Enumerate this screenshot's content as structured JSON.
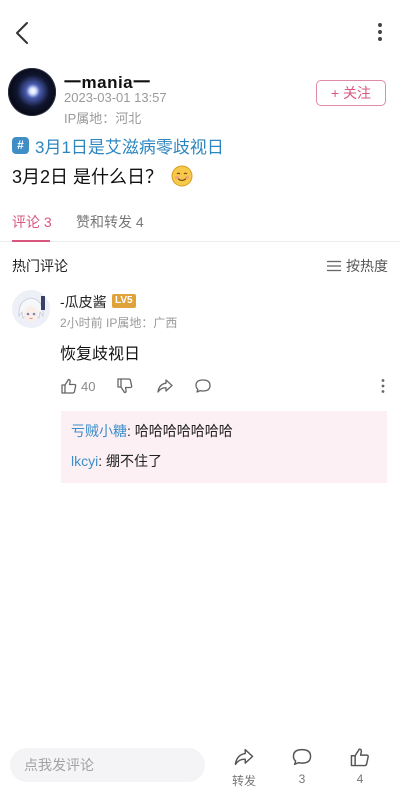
{
  "post": {
    "author_name": "一mania一",
    "time": "2023-03-01 13:57",
    "ip": "IP属地：河北",
    "follow_label": "+ 关注",
    "topic_icon": "#",
    "topic": "3月1日是艾滋病零歧视日",
    "body": "3月2日 是什么日？"
  },
  "tabs": {
    "comments": "评论 3",
    "likes_shares": "赞和转发 4"
  },
  "comments_section": {
    "title": "热门评论",
    "sort_label": "按热度"
  },
  "comment": {
    "username": "-瓜皮酱",
    "level": "LV5",
    "meta": "2小时前  IP属地：广西",
    "text": "恢复歧视日",
    "likes": "40",
    "replies": [
      {
        "user": "亏贼小糖",
        "text": "哈哈哈哈哈哈哈"
      },
      {
        "user": "lkcyi",
        "text": "绷不住了"
      }
    ]
  },
  "bottom_bar": {
    "input_placeholder": "点我发评论",
    "share_label": "转发",
    "comment_count": "3",
    "like_count": "4"
  },
  "colors": {
    "accent": "#d9577f",
    "link": "#2e86c1",
    "reply_bg": "#fcf0f5",
    "level_badge": "#e0a33a"
  },
  "icons": {
    "back": "chevron-left-icon",
    "more": "vertical-dots-icon",
    "topic": "hashtag-icon",
    "emoji": "blushing-smile-emoji-icon",
    "sort": "sort-lines-icon",
    "like": "thumbs-up-icon",
    "dislike": "thumbs-down-icon",
    "share": "share-arrow-icon",
    "reply": "speech-bubble-icon"
  }
}
